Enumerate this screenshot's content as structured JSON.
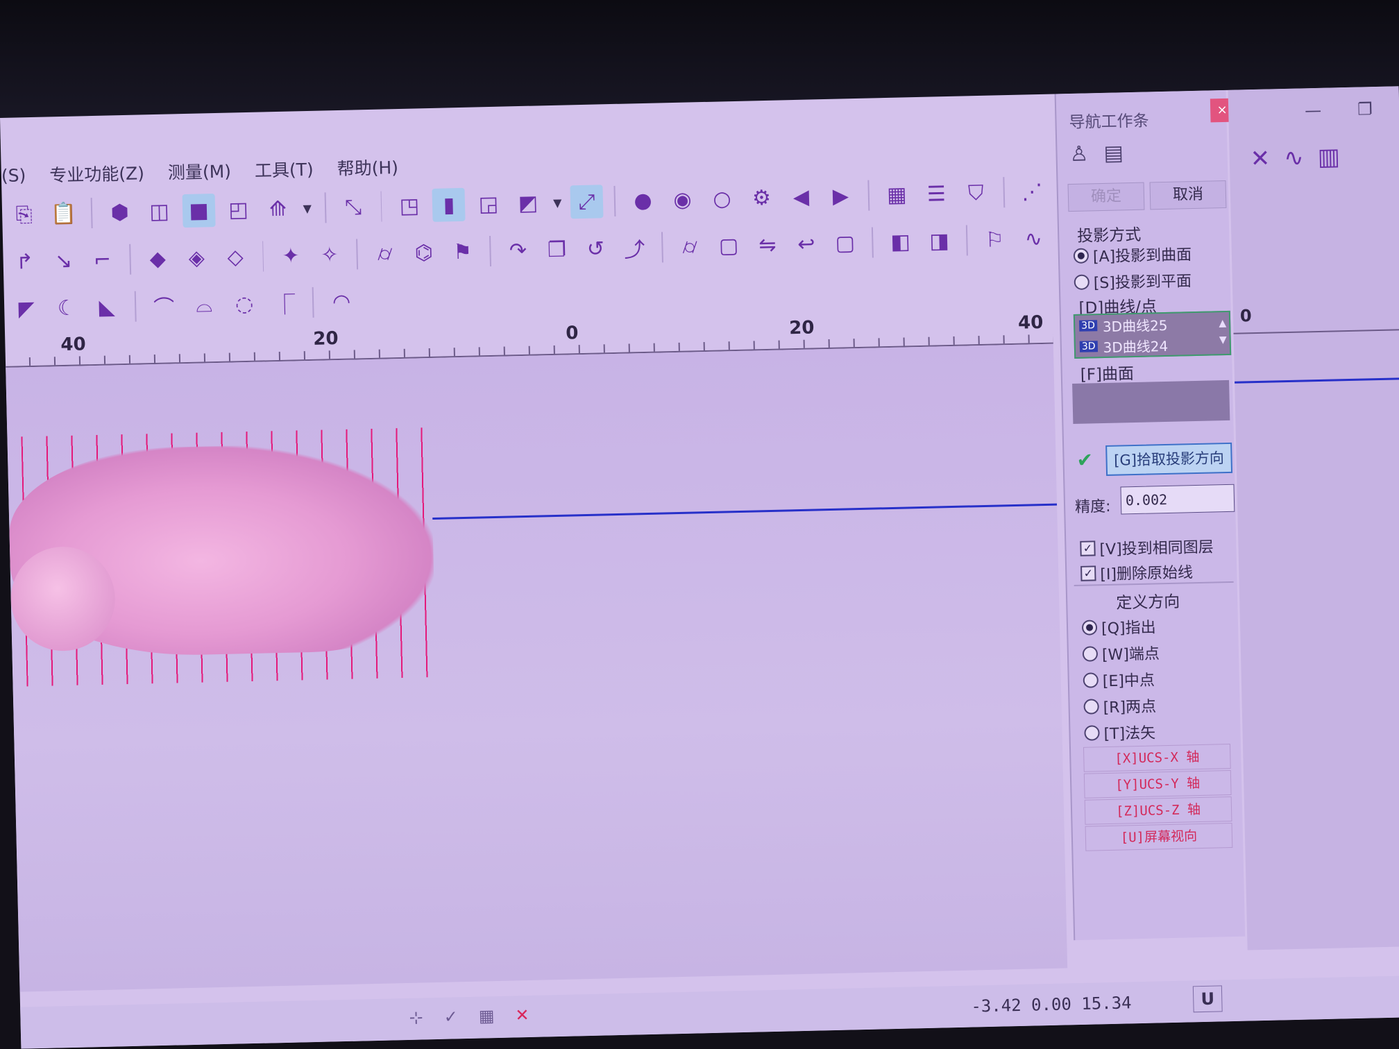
{
  "menu": [
    "(S)",
    "专业功能(Z)",
    "测量(M)",
    "工具(T)",
    "帮助(H)"
  ],
  "ruler": {
    "labels": [
      "40",
      "20",
      "0",
      "20",
      "40"
    ],
    "right_label": "0"
  },
  "nav_panel": {
    "title": "导航工作条",
    "close": "×",
    "confirm": "确定",
    "cancel": "取消",
    "projection_mode_label": "投影方式",
    "projection_surface": "[A]投影到曲面",
    "projection_plane": "[S]投影到平面",
    "curves_label": "[D]曲线/点",
    "curves": [
      {
        "badge": "3D",
        "name": "3D曲线25"
      },
      {
        "badge": "3D",
        "name": "3D曲线24"
      }
    ],
    "surface_label": "[F]曲面",
    "pick_direction": "[G]拾取投影方向",
    "precision_label": "精度:",
    "precision_value": "0.002",
    "same_layer": "[V]投到相同图层",
    "delete_original": "[I]删除原始线",
    "define_direction": "定义方向",
    "dir_options": [
      "[Q]指出",
      "[W]端点",
      "[E]中点",
      "[R]两点",
      "[T]法矢"
    ],
    "axis_buttons": [
      "[X]UCS-X 轴",
      "[Y]UCS-Y 轴",
      "[Z]UCS-Z 轴",
      "[U]屏幕视向"
    ]
  },
  "status": {
    "coords": "-3.42 0.00 15.34",
    "u_button": "U"
  }
}
